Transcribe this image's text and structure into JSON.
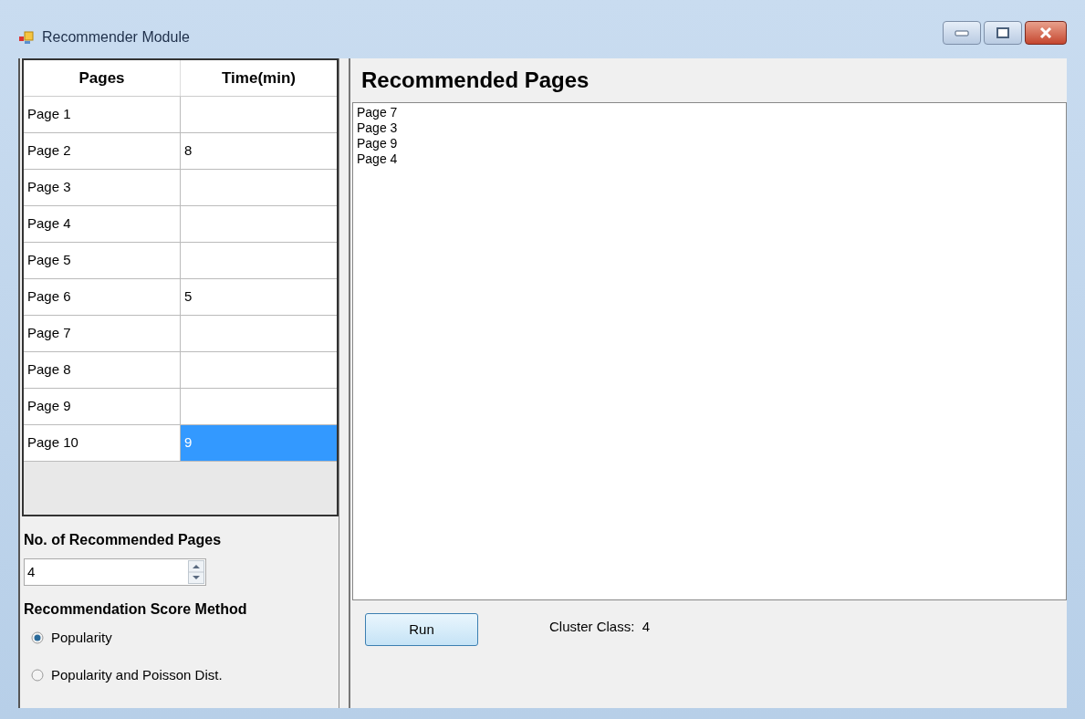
{
  "window": {
    "title": "Recommender Module"
  },
  "table": {
    "columns": [
      "Pages",
      "Time(min)"
    ],
    "rows": [
      {
        "page": "Page 1",
        "time": "",
        "selected": false
      },
      {
        "page": "Page 2",
        "time": "8",
        "selected": false
      },
      {
        "page": "Page 3",
        "time": "",
        "selected": false
      },
      {
        "page": "Page 4",
        "time": "",
        "selected": false
      },
      {
        "page": "Page 5",
        "time": "",
        "selected": false
      },
      {
        "page": "Page 6",
        "time": "5",
        "selected": false
      },
      {
        "page": "Page 7",
        "time": "",
        "selected": false
      },
      {
        "page": "Page 8",
        "time": "",
        "selected": false
      },
      {
        "page": "Page 9",
        "time": "",
        "selected": false
      },
      {
        "page": "Page 10",
        "time": "9",
        "selected": true
      }
    ]
  },
  "count": {
    "label": "No. of Recommended Pages",
    "value": "4"
  },
  "method": {
    "label": "Recommendation Score Method",
    "options": [
      {
        "label": "Popularity",
        "selected": true
      },
      {
        "label": "Popularity and Poisson Dist.",
        "selected": false
      }
    ]
  },
  "results": {
    "title": "Recommended Pages",
    "items": [
      "Page 7",
      "Page 3",
      "Page 9",
      "Page 4"
    ]
  },
  "run_button": "Run",
  "cluster_label": "Cluster Class:  4"
}
